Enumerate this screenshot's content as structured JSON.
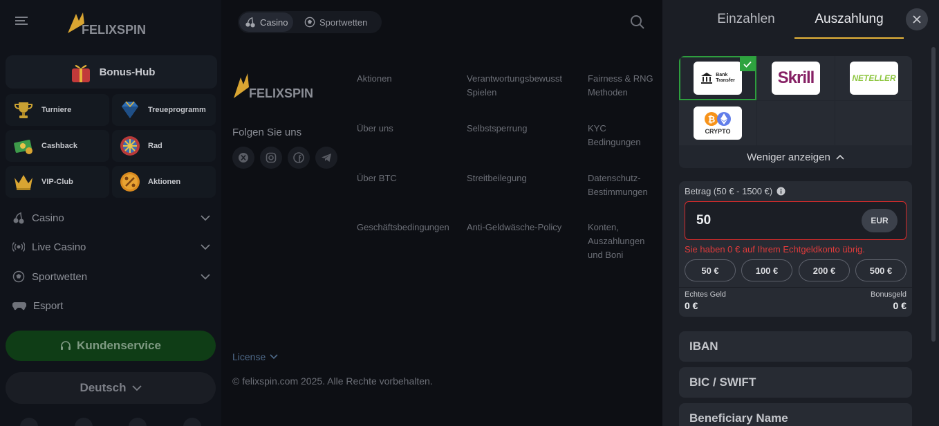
{
  "brand": {
    "name": "FELIXSPIN"
  },
  "header": {
    "tabs": [
      {
        "label": "Casino",
        "icon": "cherries-icon",
        "active": true
      },
      {
        "label": "Sportwetten",
        "icon": "soccer-ball-icon",
        "active": false
      }
    ]
  },
  "sidebar": {
    "bonus_hub": "Bonus-Hub",
    "tiles": [
      {
        "label": "Turniere",
        "icon": "trophy-icon"
      },
      {
        "label": "Treueprogramm",
        "icon": "diamond-icon"
      },
      {
        "label": "Cashback",
        "icon": "cash-icon"
      },
      {
        "label": "Rad",
        "icon": "wheel-icon"
      },
      {
        "label": "VIP-Club",
        "icon": "crown-icon"
      },
      {
        "label": "Aktionen",
        "icon": "percent-icon"
      }
    ],
    "menu": [
      {
        "label": "Casino",
        "icon": "cherries-icon",
        "expandable": true
      },
      {
        "label": "Live Casino",
        "icon": "live-icon",
        "expandable": true
      },
      {
        "label": "Sportwetten",
        "icon": "soccer-ball-icon",
        "expandable": true
      },
      {
        "label": "Esport",
        "icon": "gamepad-icon",
        "expandable": false
      }
    ],
    "support": "Kundenservice",
    "language": "Deutsch"
  },
  "footer": {
    "follow": "Folgen Sie uns",
    "columns": [
      [
        "Aktionen",
        "Über uns",
        "Über BTC",
        "Geschäftsbedingungen"
      ],
      [
        "Verantwortungsbewusst Spielen",
        "Selbstsperrung",
        "Streitbeilegung",
        "Anti-Geldwäsche-Policy"
      ],
      [
        "Fairness & RNG Methoden",
        "KYC Bedingungen",
        "Datenschutz-Bestimmungen",
        "Konten, Auszahlungen und Boni"
      ]
    ],
    "license": "License",
    "copyright": "© felixspin.com 2025. Alle Rechte vorbehalten."
  },
  "drawer": {
    "tab_deposit": "Einzahlen",
    "tab_withdraw": "Auszahlung",
    "methods": [
      {
        "name": "Bank Transfer",
        "line1": "Bank",
        "line2": "Transfer",
        "selected": true
      },
      {
        "name": "Skrill",
        "selected": false
      },
      {
        "name": "NETELLER",
        "selected": false
      },
      {
        "name": "Crypto",
        "label": "CRYPTO",
        "selected": false
      }
    ],
    "show_less": "Weniger anzeigen",
    "amount_label": "Betrag (50 € - 1500 €)",
    "amount_value": "50",
    "currency": "EUR",
    "error": "Sie haben 0 € auf Ihrem Echtgeldkonto übrig.",
    "quick_amounts": [
      "50 €",
      "100 €",
      "200 €",
      "500 €"
    ],
    "real_money_label": "Echtes Geld",
    "real_money_value": "0 €",
    "bonus_label": "Bonusgeld",
    "bonus_value": "0 €",
    "fields": [
      "IBAN",
      "BIC / SWIFT",
      "Beneficiary Name"
    ]
  },
  "colors": {
    "accent": "#e8b63a",
    "success": "#2ea33f",
    "error": "#e03b3b"
  }
}
